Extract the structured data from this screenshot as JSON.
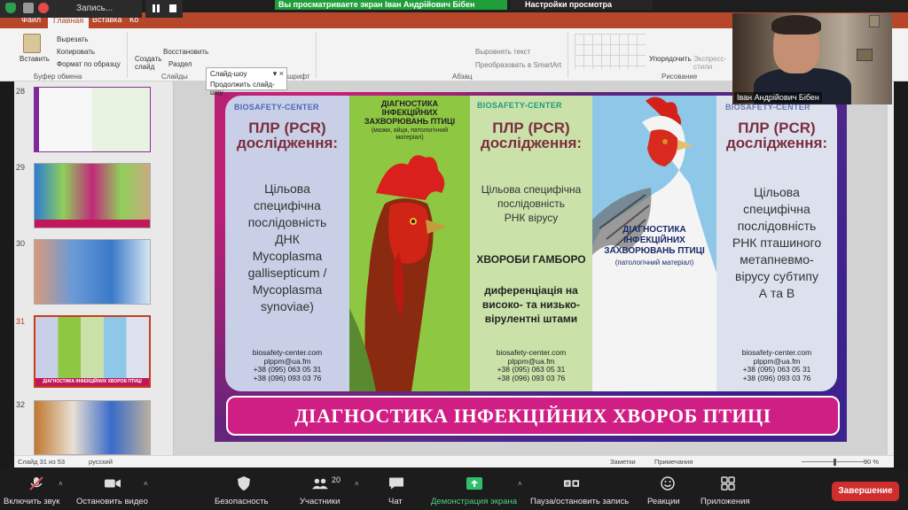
{
  "zoom_top": {
    "record_label": "Запись...",
    "share_banner": "Вы просматриваете экран Іван Андрійович Бібен",
    "view_options": "Настройки просмотра"
  },
  "ppt": {
    "tabs": [
      "Файл",
      "Главная",
      "Вставка",
      "Ко"
    ],
    "ribbon": {
      "paste": "Вставить",
      "cut": "Вырезать",
      "copy": "Копировать",
      "format_painter": "Формат по образцу",
      "group_clipboard": "Буфер обмена",
      "new_slide": "Создать слайд",
      "restore": "Восстановить",
      "section": "Раздел",
      "group_slides": "Слайды",
      "group_font_partial": "шрифт",
      "align_text": "Выровнять текст",
      "smartart": "Преобразовать в SmartArt",
      "group_paragraph": "Абзац",
      "arrange": "Упорядочить",
      "express_styles": "Экспресс-стили",
      "group_drawing": "Рисование"
    },
    "popup": {
      "title": "Слайд-шоу",
      "item": "Продолжить слайд-шоу"
    },
    "thumbs": [
      {
        "num": "28",
        "selected": false
      },
      {
        "num": "29",
        "selected": false
      },
      {
        "num": "30",
        "selected": false
      },
      {
        "num": "31",
        "selected": true
      },
      {
        "num": "32",
        "selected": false
      }
    ],
    "thumb31_caption": "ДІАГНОСТИКА ІНФЕКЦІЙНИХ ХВОРОБ ПТИЦІ",
    "status": {
      "slide_counter": "Слайд 31 из 53",
      "language": "русский",
      "notes": "Заметки",
      "comments": "Примечания",
      "zoom": "90 %"
    }
  },
  "slide": {
    "brand": "BIOSAFETY-CENTER",
    "panel_a": {
      "title": "ПЛР (PCR) дослідження:",
      "body": [
        "Цільова",
        "специфічна",
        "послідовність",
        "ДНК",
        "Mycoplasma",
        "gallisepticum /",
        "Mycoplasma",
        "synoviae)"
      ]
    },
    "panel_b": {
      "title_lines": [
        "ДІАГНОСТИКА",
        "ІНФЕКЦІЙНИХ",
        "ЗАХВОРЮВАНЬ ПТИЦІ"
      ],
      "subtitle": "(мазки, яйця, патологічний матеріал)"
    },
    "panel_c": {
      "title": "ПЛР (PCR) дослідження:",
      "body": [
        "Цільова специфічна",
        "послідовність",
        "РНК вірусу"
      ],
      "disease": "ХВОРОБИ ГАМБОРО",
      "diff": [
        "диференціація на",
        "високо- та низько-",
        "вірулентні штами"
      ]
    },
    "panel_d": {
      "title_lines": [
        "ДІАГНОСТИКА",
        "ІНФЕКЦІЙНИХ",
        "ЗАХВОРЮВАНЬ ПТИЦІ"
      ],
      "subtitle": "(патологічний матеріал)"
    },
    "panel_e": {
      "title": "ПЛР (PCR) дослідження:",
      "body": [
        "Цільова",
        "специфічна",
        "послідовність",
        "РНК пташиного",
        "метапневмо-",
        "вірусу субтипу",
        "А та В"
      ]
    },
    "contact": [
      "biosafety-center.com",
      "plppm@ua.fm",
      "+38 (095) 063 05 31",
      "+38 (096) 093 03 76"
    ],
    "banner": "ДІАГНОСТИКА ІНФЕКЦІЙНИХ ХВОРОБ ПТИЦІ"
  },
  "camera": {
    "name": "Іван Андрійович Бібен"
  },
  "zoom_bottom": {
    "mute": "Включить звук",
    "video": "Остановить видео",
    "security": "Безопасность",
    "participants": "Участники",
    "participants_count": "20",
    "chat": "Чат",
    "share": "Демонстрация экрана",
    "pause_record": "Пауза/остановить запись",
    "reactions": "Реакции",
    "apps": "Приложения",
    "end": "Завершение"
  },
  "colors": {
    "ppt_accent": "#b7472a",
    "zoom_green": "#1f9e3a",
    "slide_magenta": "#d01f84",
    "end_red": "#cf2e2e"
  }
}
